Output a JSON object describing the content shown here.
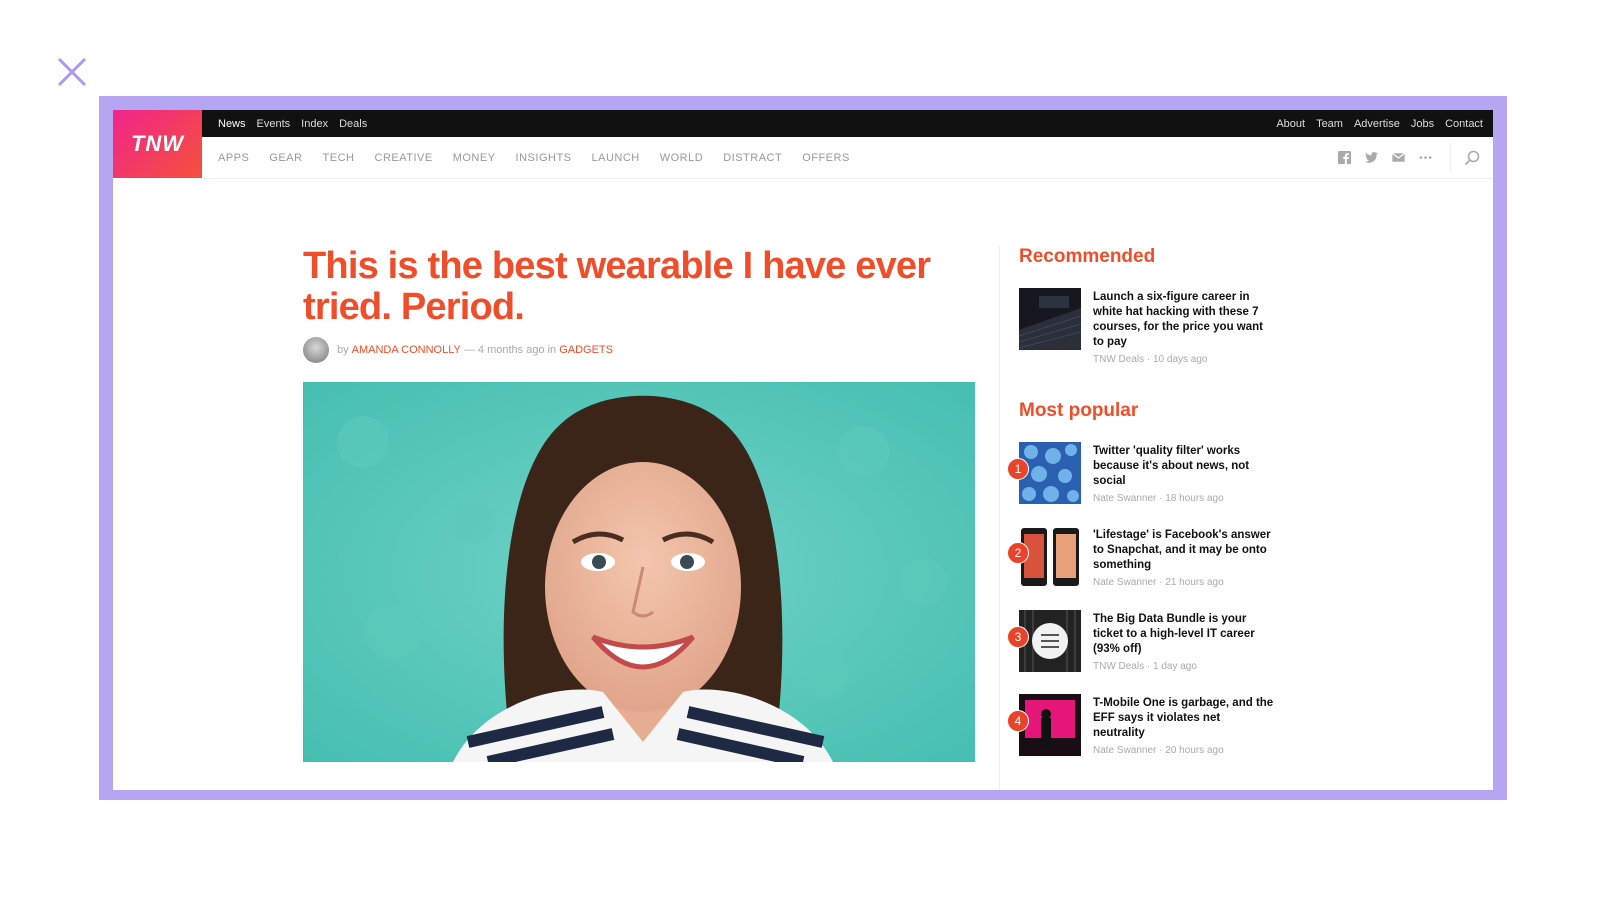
{
  "top_nav": {
    "left": [
      "News",
      "Events",
      "Index",
      "Deals"
    ],
    "right": [
      "About",
      "Team",
      "Advertise",
      "Jobs",
      "Contact"
    ]
  },
  "logo_text": "TNW",
  "categories": [
    "APPS",
    "GEAR",
    "TECH",
    "CREATIVE",
    "MONEY",
    "INSIGHTS",
    "LAUNCH",
    "WORLD",
    "DISTRACT",
    "OFFERS"
  ],
  "article": {
    "title": "This is the best wearable I have ever tried. Period.",
    "by": "by",
    "author": "AMANDA CONNOLLY",
    "time": "— 4 months ago in",
    "category": "GADGETS"
  },
  "recommended": {
    "title": "Recommended",
    "item": {
      "title": "Launch a six-figure career in white hat hacking with these 7 courses, for the price you want to pay",
      "meta": "TNW Deals · 10 days ago"
    }
  },
  "popular": {
    "title": "Most popular",
    "items": [
      {
        "num": "1",
        "title": "Twitter 'quality filter' works because it's about news, not social",
        "meta": "Nate Swanner · 18 hours ago"
      },
      {
        "num": "2",
        "title": "'Lifestage' is Facebook's answer to Snapchat, and it may be onto something",
        "meta": "Nate Swanner · 21 hours ago"
      },
      {
        "num": "3",
        "title": "The Big Data Bundle is your ticket to a high-level IT career (93% off)",
        "meta": "TNW Deals · 1 day ago"
      },
      {
        "num": "4",
        "title": "T-Mobile One is garbage, and the EFF says it violates net neutrality",
        "meta": "Nate Swanner · 20 hours ago"
      }
    ]
  },
  "colors": {
    "accent": "#f04e2a",
    "frame": "#b4a6f3",
    "topbar": "#111111"
  }
}
